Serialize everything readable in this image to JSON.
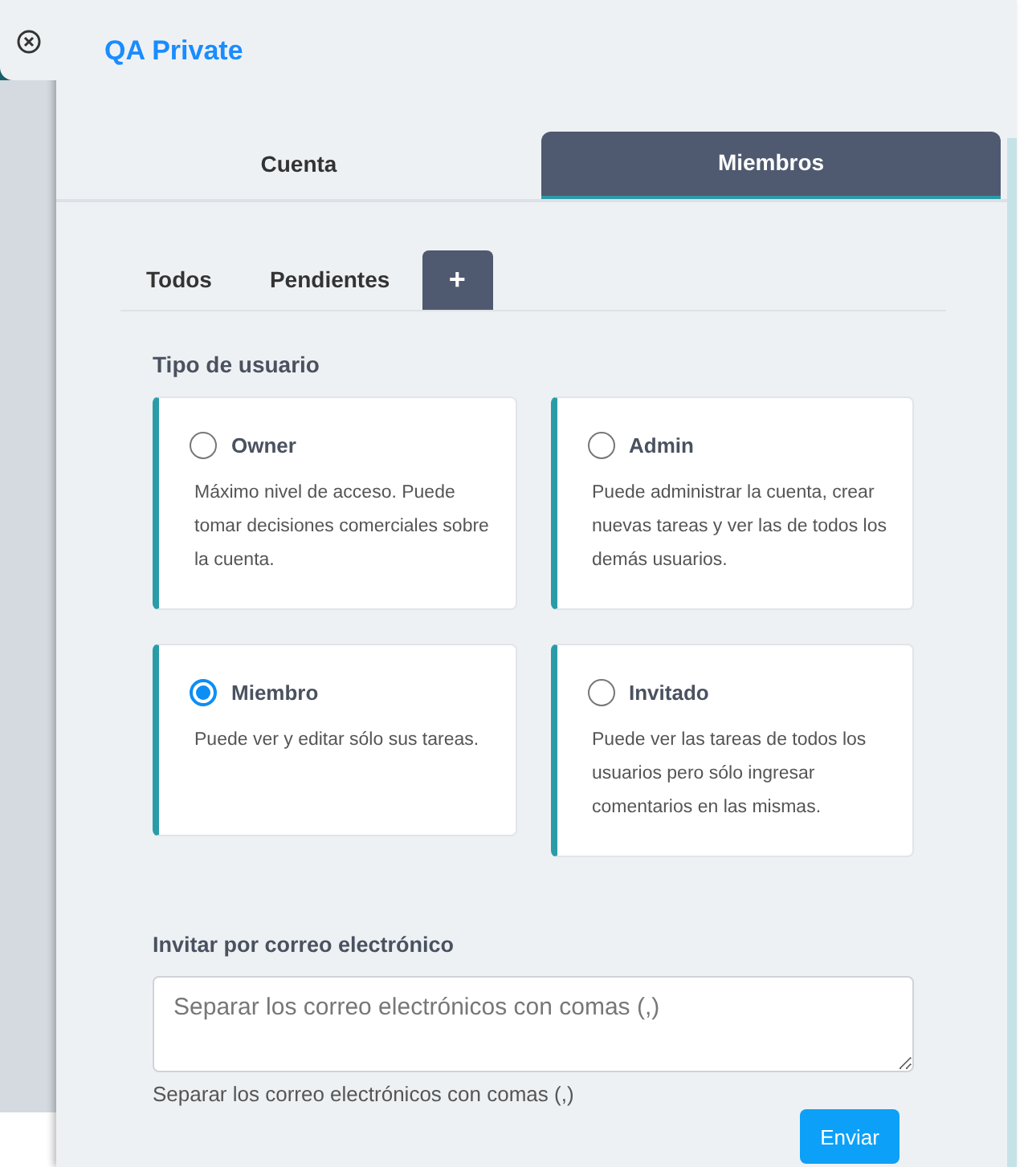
{
  "title": "QA Private",
  "tabs": [
    {
      "label": "Cuenta",
      "selected": false
    },
    {
      "label": "Miembros",
      "selected": true
    }
  ],
  "subtabs": [
    {
      "label": "Todos",
      "kind": "text"
    },
    {
      "label": "Pendientes",
      "kind": "text"
    },
    {
      "label": "+",
      "kind": "add"
    }
  ],
  "user_type": {
    "label": "Tipo de usuario",
    "options": [
      {
        "name": "Owner",
        "description": "Máximo nivel de acceso. Puede tomar decisiones comerciales sobre la cuenta.",
        "selected": false
      },
      {
        "name": "Admin",
        "description": "Puede administrar la cuenta, crear nuevas tareas y ver las de todos los demás usuarios.",
        "selected": false
      },
      {
        "name": "Miembro",
        "description": "Puede ver y editar sólo sus tareas.",
        "selected": true
      },
      {
        "name": "Invitado",
        "description": "Puede ver las tareas de todos los usuarios pero sólo ingresar comentarios en las mismas.",
        "selected": false
      }
    ]
  },
  "invite": {
    "label": "Invitar por correo electrónico",
    "placeholder": "Separar los correo electrónicos con comas (,)",
    "help": "Separar los correo electrónicos con comas (,)",
    "button": "Enviar"
  }
}
